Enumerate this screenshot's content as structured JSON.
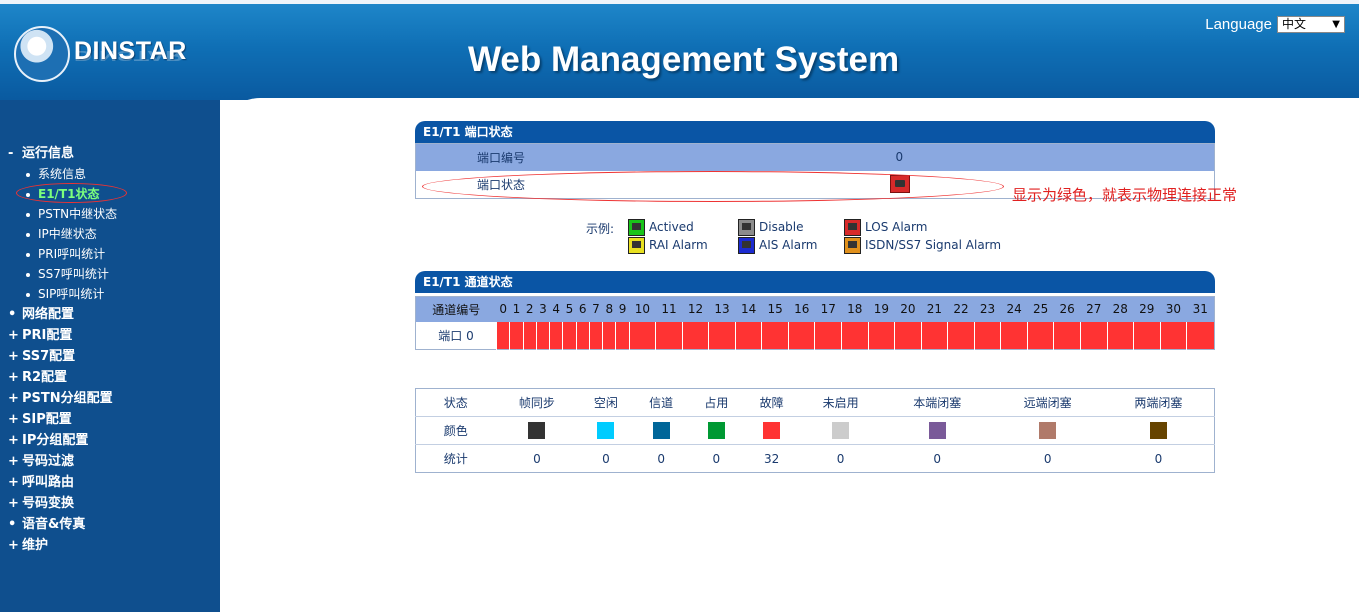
{
  "header": {
    "brand": "DINSTAR",
    "title": "Web Management System",
    "language_label": "Language",
    "language_value": "中文"
  },
  "sidebar": {
    "groups": [
      {
        "label": "运行信息",
        "marker": "-",
        "expanded": true,
        "items": [
          "系统信息",
          "E1/T1状态",
          "PSTN中继状态",
          "IP中继状态",
          "PRI呼叫统计",
          "SS7呼叫统计",
          "SIP呼叫统计"
        ],
        "active_item": "E1/T1状态"
      },
      {
        "label": "网络配置",
        "marker": "•"
      },
      {
        "label": "PRI配置",
        "marker": "+"
      },
      {
        "label": "SS7配置",
        "marker": "+"
      },
      {
        "label": "R2配置",
        "marker": "+"
      },
      {
        "label": "PSTN分组配置",
        "marker": "+"
      },
      {
        "label": "SIP配置",
        "marker": "+"
      },
      {
        "label": "IP分组配置",
        "marker": "+"
      },
      {
        "label": "号码过滤",
        "marker": "+"
      },
      {
        "label": "呼叫路由",
        "marker": "+"
      },
      {
        "label": "号码变换",
        "marker": "+"
      },
      {
        "label": "语音&传真",
        "marker": "•"
      },
      {
        "label": "维护",
        "marker": "+"
      }
    ]
  },
  "port_panel": {
    "title": "E1/T1 端口状态",
    "port_number_label": "端口编号",
    "port_number_value": "0",
    "port_status_label": "端口状态",
    "port_status_color": "#d82a2a"
  },
  "annotation": "显示为绿色，就表示物理连接正常",
  "legend": {
    "label": "示例:",
    "items": [
      {
        "label": "Actived",
        "color": "#19c419"
      },
      {
        "label": "Disable",
        "color": "#8c8c8c"
      },
      {
        "label": "LOS Alarm",
        "color": "#d82a2a"
      },
      {
        "label": "RAI Alarm",
        "color": "#e8e020"
      },
      {
        "label": "AIS Alarm",
        "color": "#1c2bd0"
      },
      {
        "label": "ISDN/SS7 Signal Alarm",
        "color": "#e0901c"
      }
    ]
  },
  "channel_panel": {
    "title": "E1/T1 通道状态",
    "channel_label": "通道编号",
    "channels": [
      "0",
      "1",
      "2",
      "3",
      "4",
      "5",
      "6",
      "7",
      "8",
      "9",
      "10",
      "11",
      "12",
      "13",
      "14",
      "15",
      "16",
      "17",
      "18",
      "19",
      "20",
      "21",
      "22",
      "23",
      "24",
      "25",
      "26",
      "27",
      "28",
      "29",
      "30",
      "31"
    ],
    "row_label": "端口 0",
    "cell_color": "#ff3333"
  },
  "stats": {
    "row_labels": [
      "状态",
      "颜色",
      "统计"
    ],
    "columns": [
      {
        "label": "帧同步",
        "color": "#333333",
        "count": "0"
      },
      {
        "label": "空闲",
        "color": "#00ccff",
        "count": "0"
      },
      {
        "label": "信道",
        "color": "#006699",
        "count": "0"
      },
      {
        "label": "占用",
        "color": "#009933",
        "count": "0"
      },
      {
        "label": "故障",
        "color": "#ff3333",
        "count": "32"
      },
      {
        "label": "未启用",
        "color": "#cccccc",
        "count": "0"
      },
      {
        "label": "本端闭塞",
        "color": "#7a5a99",
        "count": "0"
      },
      {
        "label": "远端闭塞",
        "color": "#b07a6a",
        "count": "0"
      },
      {
        "label": "两端闭塞",
        "color": "#664400",
        "count": "0"
      }
    ]
  }
}
